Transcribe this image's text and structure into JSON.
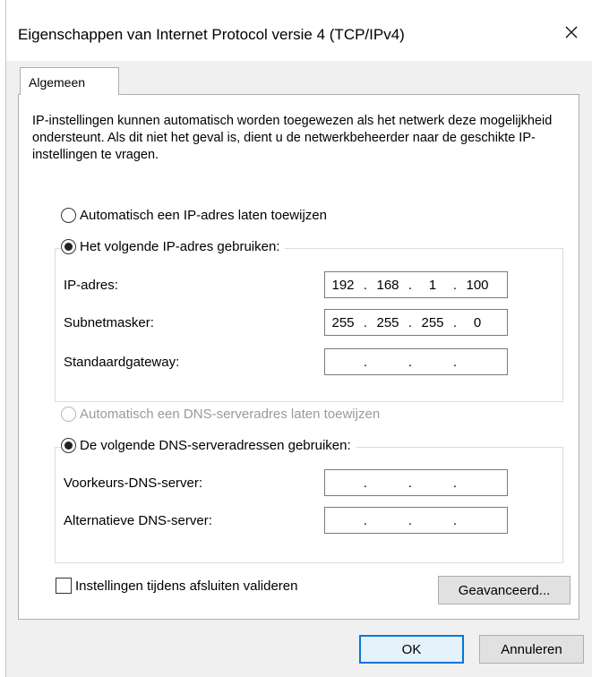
{
  "window": {
    "title": "Eigenschappen van Internet Protocol versie 4 (TCP/IPv4)",
    "close_glyph": "✕"
  },
  "tabs": [
    {
      "label": "Algemeen",
      "selected": true
    }
  ],
  "info_text": "IP-instellingen kunnen automatisch worden toegewezen als het netwerk deze mogelijkheid ondersteunt. Als dit niet het geval is, dient u de netwerkbeheerder naar de geschikte IP-instellingen te vragen.",
  "ip_section": {
    "auto_option": {
      "label": "Automatisch een IP-adres laten toewijzen",
      "selected": false
    },
    "manual_option": {
      "label": "Het volgende IP-adres gebruiken:",
      "selected": true
    },
    "fields": [
      {
        "label": "IP-adres:",
        "octets": [
          "192",
          "168",
          "1",
          "100"
        ]
      },
      {
        "label": "Subnetmasker:",
        "octets": [
          "255",
          "255",
          "255",
          "0"
        ]
      },
      {
        "label": "Standaardgateway:",
        "octets": [
          "",
          "",
          "",
          ""
        ]
      }
    ]
  },
  "dns_section": {
    "auto_option": {
      "label": "Automatisch een DNS-serveradres laten toewijzen",
      "selected": false,
      "disabled": true
    },
    "manual_option": {
      "label": "De volgende DNS-serveradressen gebruiken:",
      "selected": true
    },
    "fields": [
      {
        "label": "Voorkeurs-DNS-server:",
        "octets": [
          "",
          "",
          "",
          ""
        ]
      },
      {
        "label": "Alternatieve DNS-server:",
        "octets": [
          "",
          "",
          "",
          ""
        ]
      }
    ]
  },
  "validate_checkbox": {
    "label": "Instellingen tijdens afsluiten valideren",
    "checked": false
  },
  "buttons": {
    "advanced": "Geavanceerd...",
    "ok": "OK",
    "cancel": "Annuleren"
  }
}
